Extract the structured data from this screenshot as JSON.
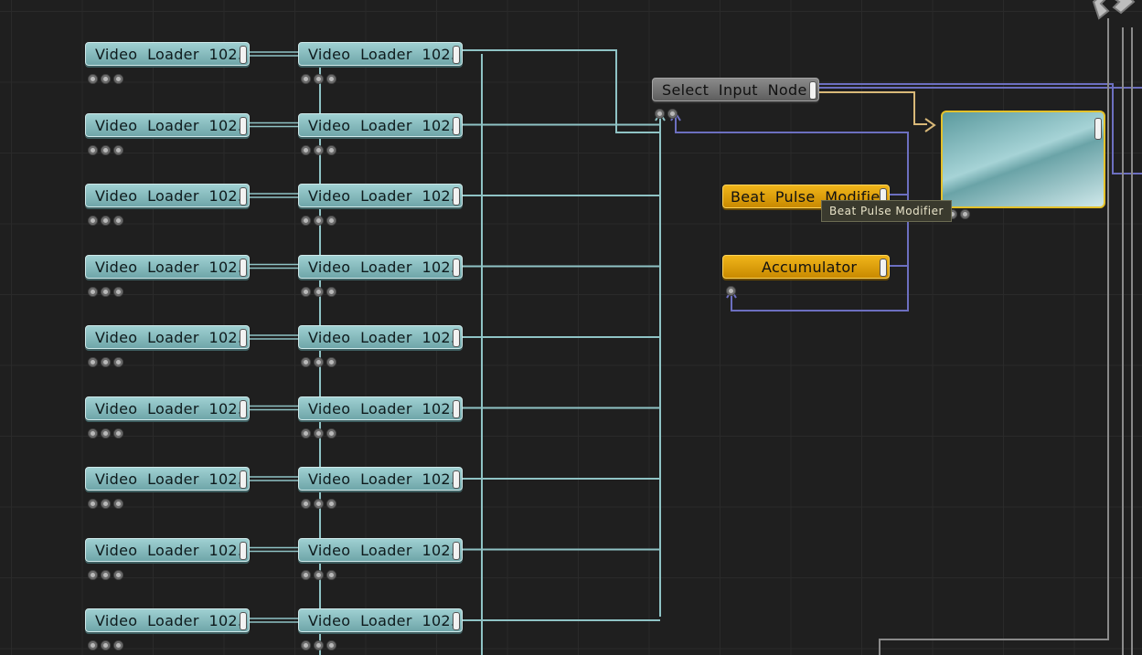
{
  "video_loader_label": "Video  Loader  102...",
  "video_loader_rows": 9,
  "select_node": {
    "label": "Select  Input  Node"
  },
  "beat_pulse_node": {
    "label": "Beat  Pulse  Modifier"
  },
  "accumulator_node": {
    "label": "Accumulator"
  },
  "tooltip": {
    "text": "Beat  Pulse  Modifier"
  },
  "colors": {
    "background": "#1f1f1f",
    "video_node": "#8fc3c5",
    "amber_node": "#e6a80e",
    "select_node": "#777777",
    "wire_video": "#8fc3c5",
    "wire_blue": "#6c6fc0",
    "wire_amber": "#d8b878",
    "wire_gray": "#8a8a8a"
  }
}
